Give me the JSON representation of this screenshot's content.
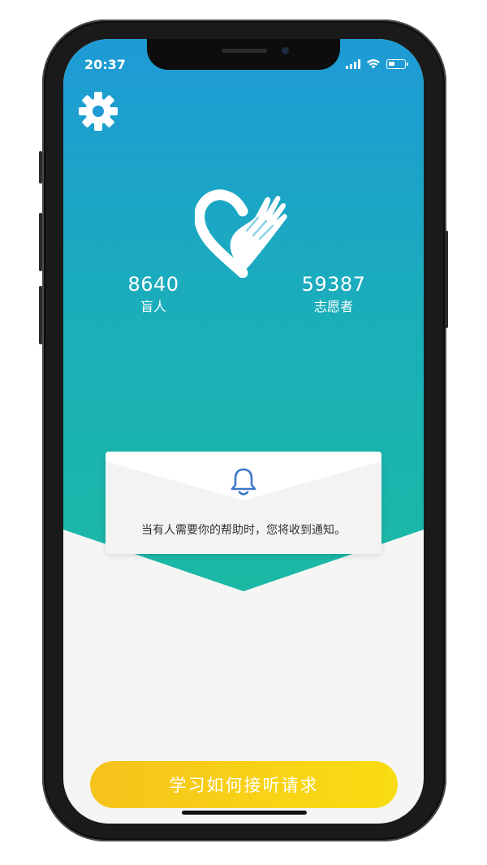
{
  "status_bar": {
    "time": "20:37"
  },
  "stats": {
    "blind": {
      "value": "8640",
      "label": "盲人"
    },
    "volunteers": {
      "value": "59387",
      "label": "志愿者"
    }
  },
  "notice": {
    "text": "当有人需要你的帮助时，您将收到通知。"
  },
  "cta": {
    "label": "学习如何接听请求"
  },
  "colors": {
    "hero_top": "#1e9ad6",
    "hero_bottom": "#1bb9a3",
    "button_start": "#f6c21c",
    "button_end": "#f9dc12",
    "bell": "#3a78c9",
    "background": "#f5f5f5"
  },
  "icons": [
    "gear-icon",
    "heart-hand-logo",
    "bell-icon",
    "signal-icon",
    "wifi-icon",
    "battery-icon"
  ]
}
